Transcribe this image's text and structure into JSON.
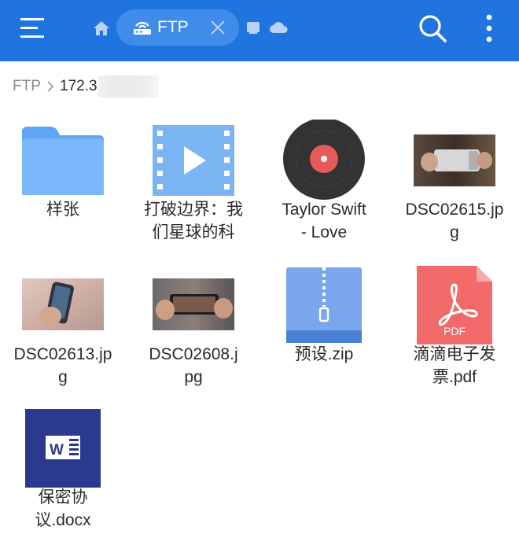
{
  "toolbar": {
    "menu_icon": "hamburger-menu-icon",
    "home_icon": "home-icon",
    "active_tab": {
      "label": "FTP",
      "icon": "ftp-router-icon",
      "close_icon": "close-icon"
    },
    "other_tabs": [
      "window-icon",
      "cloud-icon"
    ],
    "search_icon": "search-icon",
    "more_icon": "more-vertical-icon",
    "accent_color": "#1f74e0"
  },
  "breadcrumb": {
    "root": "FTP",
    "current": "172.3"
  },
  "files": [
    {
      "name": "样张",
      "type": "folder"
    },
    {
      "name": "打破边界：我\n们星球的科",
      "type": "video"
    },
    {
      "name": "Taylor Swift\n- Love",
      "type": "audio"
    },
    {
      "name": "DSC02615.jp\ng",
      "type": "image-photo"
    },
    {
      "name": "DSC02613.jp\ng",
      "type": "image-photo"
    },
    {
      "name": "DSC02608.j\npg",
      "type": "image-photo"
    },
    {
      "name": "预设.zip",
      "type": "zip"
    },
    {
      "name": "滴滴电子发\n票.pdf",
      "type": "pdf"
    },
    {
      "name": "保密协\n议.docx",
      "type": "word"
    }
  ]
}
